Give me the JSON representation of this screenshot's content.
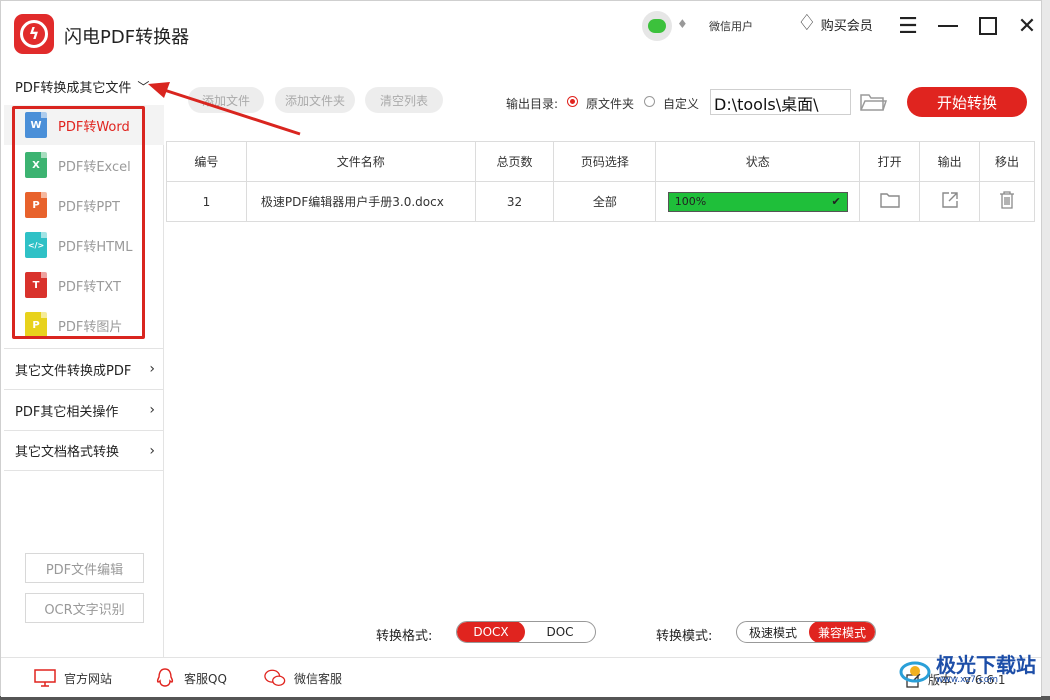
{
  "app": {
    "title": "闪电PDF转换器",
    "user_label": "微信用户",
    "buy_vip": "购买会员"
  },
  "sidebar": {
    "section_title": "PDF转换成其它文件",
    "sub_items": [
      {
        "label": "PDF转Word",
        "icon": "word-file-icon",
        "badge": "W",
        "color": "#4a8fd8"
      },
      {
        "label": "PDF转Excel",
        "icon": "excel-file-icon",
        "badge": "X",
        "color": "#3cb371"
      },
      {
        "label": "PDF转PPT",
        "icon": "ppt-file-icon",
        "badge": "P",
        "color": "#e8622c"
      },
      {
        "label": "PDF转HTML",
        "icon": "html-file-icon",
        "badge": "</>",
        "color": "#2fc1c6"
      },
      {
        "label": "PDF转TXT",
        "icon": "txt-file-icon",
        "badge": "T",
        "color": "#d9322c"
      },
      {
        "label": "PDF转图片",
        "icon": "image-file-icon",
        "badge": "P",
        "color": "#e8d21c"
      }
    ],
    "groups": [
      "其它文件转换成PDF",
      "PDF其它相关操作",
      "其它文档格式转换"
    ],
    "tool_buttons": [
      "PDF文件编辑",
      "OCR文字识别"
    ]
  },
  "toolbar": {
    "add_file": "添加文件",
    "add_folder": "添加文件夹",
    "clear_list": "清空列表",
    "output_label": "输出目录:",
    "radio_original": "原文件夹",
    "radio_custom": "自定义",
    "output_path": "D:\\tools\\桌面\\",
    "start": "开始转换"
  },
  "table": {
    "headers": [
      "编号",
      "文件名称",
      "总页数",
      "页码选择",
      "状态",
      "打开",
      "输出",
      "移出"
    ],
    "rows": [
      {
        "index": "1",
        "name": "极速PDF编辑器用户手册3.0.docx",
        "pages": "32",
        "range": "全部",
        "progress_label": "100%",
        "progress": 1.0
      }
    ]
  },
  "bottom": {
    "format_label": "转换格式:",
    "formats": [
      "DOCX",
      "DOC"
    ],
    "selected_format": "DOCX",
    "mode_label": "转换模式:",
    "modes": [
      "极速模式",
      "兼容模式"
    ],
    "selected_mode": "兼容模式"
  },
  "footer": {
    "website": "官方网站",
    "qq": "客服QQ",
    "wechat": "微信客服",
    "version": "版本：v 6.6.1"
  },
  "watermark": {
    "text": "极光下载站",
    "sub": "www.xz7.com"
  },
  "colors": {
    "accent": "#e0241f",
    "progress": "#1fbf3a",
    "annotation": "#d9251f"
  }
}
